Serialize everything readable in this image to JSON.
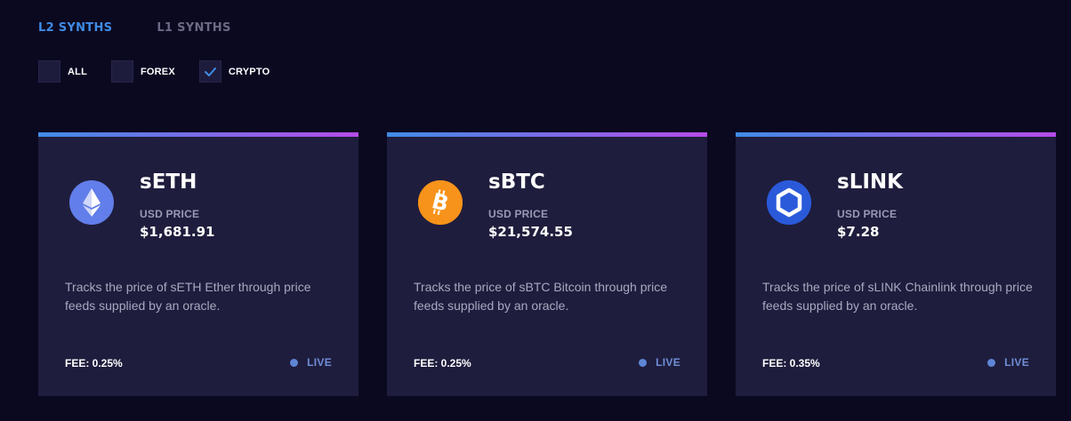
{
  "tabs": [
    {
      "label": "L2 SYNTHS",
      "active": true
    },
    {
      "label": "L1 SYNTHS",
      "active": false
    }
  ],
  "filters": [
    {
      "label": "ALL",
      "checked": false
    },
    {
      "label": "FOREX",
      "checked": false
    },
    {
      "label": "CRYPTO",
      "checked": true
    }
  ],
  "price_label": "USD PRICE",
  "fee_prefix": "FEE:",
  "colors": {
    "accent_blue": "#3f8ce6",
    "accent_purple": "#b64be8",
    "card_bg": "#1f1d3d",
    "page_bg": "#0b0920"
  },
  "cards": [
    {
      "icon": "ethereum-icon",
      "name": "sETH",
      "price_label": "USD PRICE",
      "price": "$1,681.91",
      "description": "Tracks the price of sETH Ether through price feeds supplied by an oracle.",
      "fee": "FEE: 0.25%",
      "status": "LIVE"
    },
    {
      "icon": "bitcoin-icon",
      "name": "sBTC",
      "price_label": "USD PRICE",
      "price": "$21,574.55",
      "description": "Tracks the price of sBTC Bitcoin through price feeds supplied by an oracle.",
      "fee": "FEE: 0.25%",
      "status": "LIVE"
    },
    {
      "icon": "chainlink-icon",
      "name": "sLINK",
      "price_label": "USD PRICE",
      "price": "$7.28",
      "description": "Tracks the price of sLINK Chainlink through price feeds supplied by an oracle.",
      "fee": "FEE: 0.35%",
      "status": "LIVE"
    }
  ]
}
